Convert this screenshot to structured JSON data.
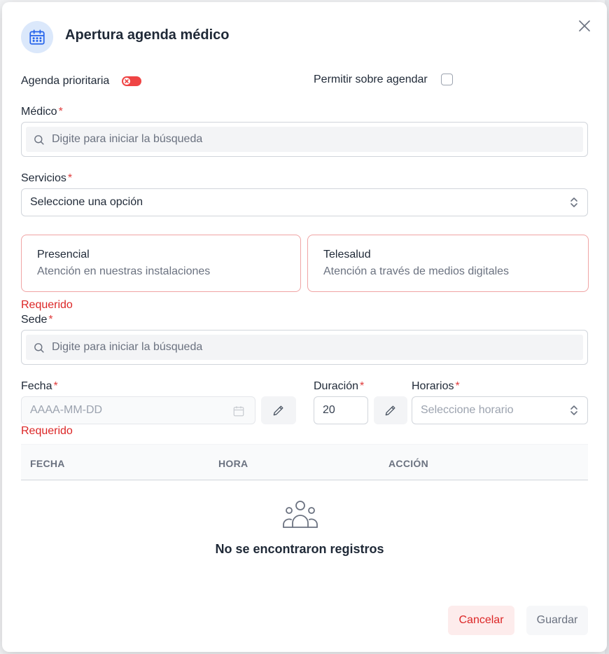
{
  "dialog": {
    "title": "Apertura agenda médico",
    "icon": "calendar-icon",
    "close_icon": "close-icon"
  },
  "priority": {
    "label": "Agenda prioritaria",
    "enabled": false,
    "toggle_color": "#ef4444"
  },
  "overbook": {
    "label": "Permitir sobre agendar",
    "checked": false
  },
  "medico": {
    "label": "Médico",
    "required_mark": "*",
    "placeholder": "Digite para iniciar la búsqueda"
  },
  "servicios": {
    "label": "Servicios",
    "required_mark": "*",
    "value": "Seleccione una opción"
  },
  "modes": [
    {
      "title": "Presencial",
      "desc": "Atención en nuestras instalaciones"
    },
    {
      "title": "Telesalud",
      "desc": "Atención a través de medios digitales"
    }
  ],
  "modes_error": "Requerido",
  "sede": {
    "label": "Sede",
    "required_mark": "*",
    "placeholder": "Digite para iniciar la búsqueda"
  },
  "fecha": {
    "label": "Fecha",
    "required_mark": "*",
    "placeholder": "AAAA-MM-DD",
    "error": "Requerido"
  },
  "duracion": {
    "label": "Duración",
    "required_mark": "*",
    "value": "20"
  },
  "horarios": {
    "label": "Horarios",
    "required_mark": "*",
    "placeholder": "Seleccione horario"
  },
  "table": {
    "headers": [
      "FECHA",
      "HORA",
      "ACCIÓN"
    ],
    "empty_text": "No se encontraron registros",
    "empty_icon": "users-icon"
  },
  "actions": {
    "cancel": "Cancelar",
    "save": "Guardar"
  },
  "colors": {
    "accent": "#2563eb",
    "error": "#dc2626",
    "icon_bg": "#dbe8fb"
  }
}
